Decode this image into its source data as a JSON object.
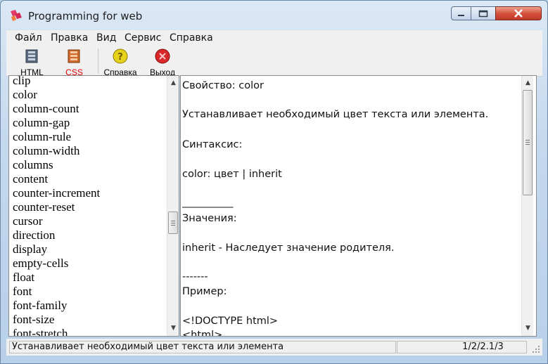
{
  "window": {
    "title": "Programming for web"
  },
  "menu": [
    "Файл",
    "Правка",
    "Вид",
    "Сервис",
    "Справка"
  ],
  "toolbar": {
    "html_label": "HTML",
    "css_label": "CSS",
    "help_label": "Справка",
    "exit_label": "Выход",
    "css_label_color": "#e00000"
  },
  "properties": [
    "clip",
    "color",
    "column-count",
    "column-gap",
    "column-rule",
    "column-width",
    "columns",
    "content",
    "counter-increment",
    "counter-reset",
    "cursor",
    "direction",
    "display",
    "empty-cells",
    "float",
    "font",
    "font-family",
    "font-size",
    "font-stretch"
  ],
  "selected_property": "color",
  "content": {
    "line1": "Свойство: color",
    "line2": "Устанавливает необходимый цвет текста или элемента.",
    "line3": "Синтаксис:",
    "line4": "color: цвет | inherit",
    "line5": "__________",
    "line6": "Значения:",
    "line7": "inherit - Наследует значение родителя.",
    "line8": "-------",
    "line9": "Пример:",
    "line10": "<!DOCTYPE html>",
    "line11": "<html>"
  },
  "status": {
    "message": "Устанавливает необходимый цвет текста или элемента",
    "version": "1/2/2.1/3"
  }
}
